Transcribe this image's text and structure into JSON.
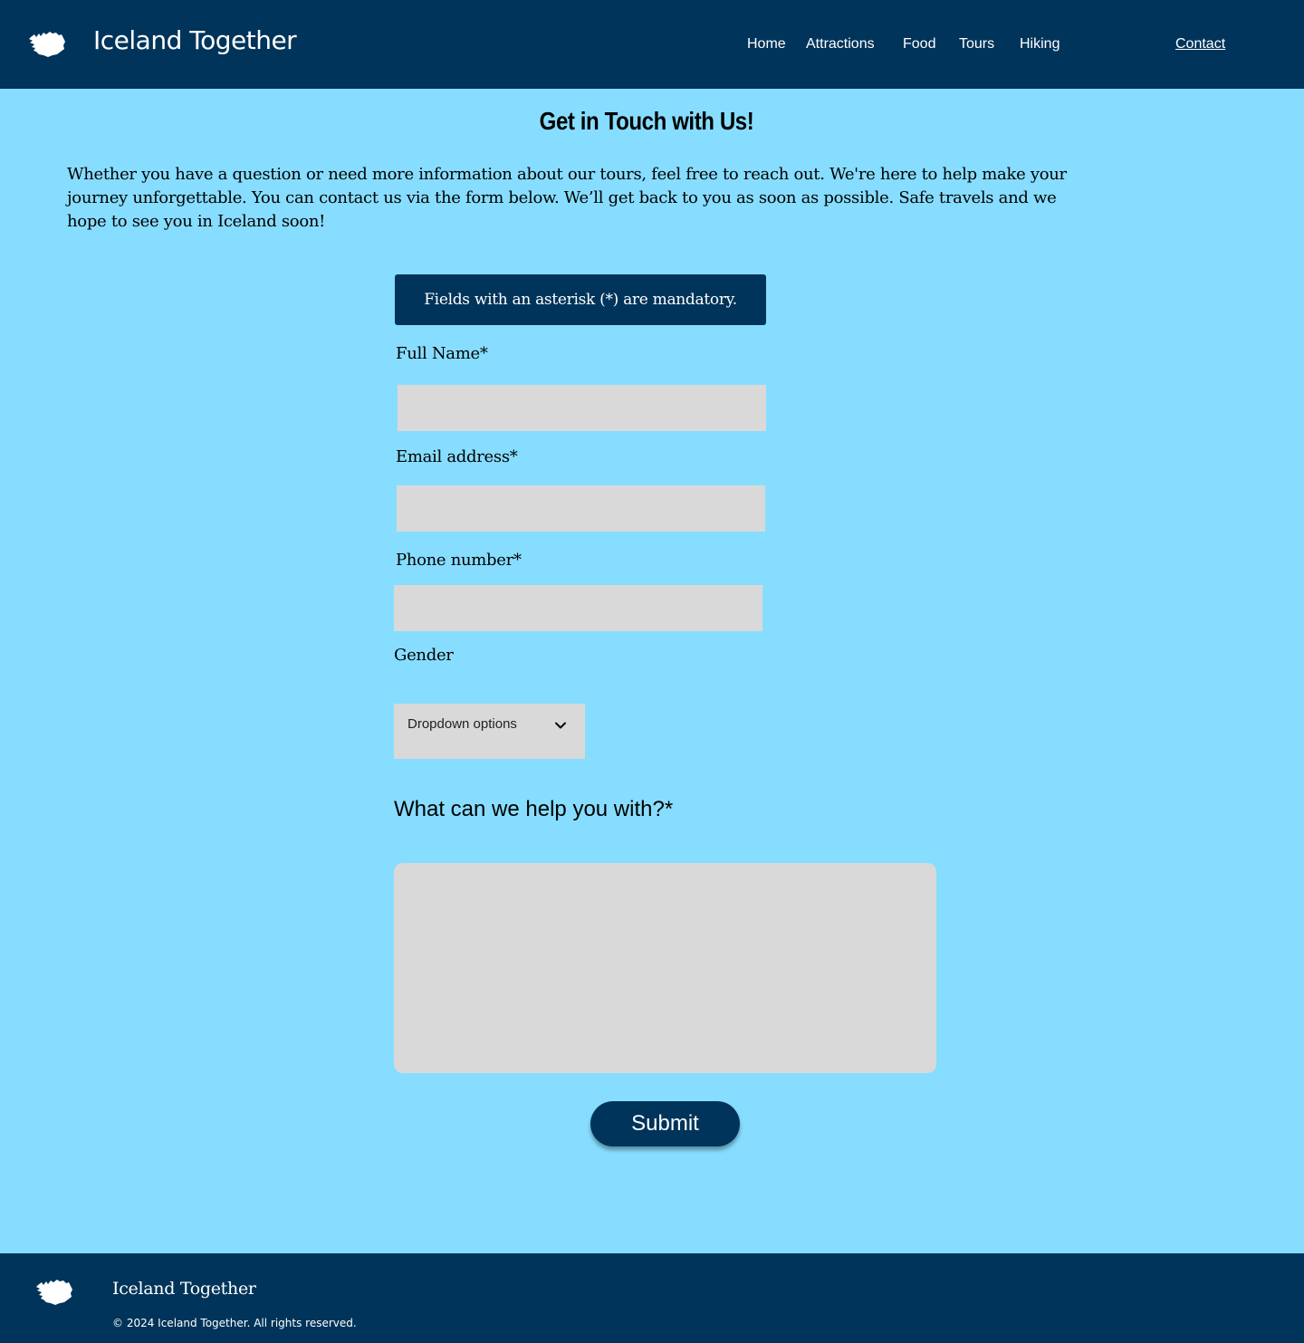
{
  "header": {
    "brand": "Iceland Together",
    "logo_icon": "iceland-map-icon",
    "nav": [
      {
        "label": "Home"
      },
      {
        "label": "Attractions"
      },
      {
        "label": "Food"
      },
      {
        "label": "Tours"
      },
      {
        "label": "Hiking"
      },
      {
        "label": "Contact",
        "active": true
      }
    ]
  },
  "main": {
    "title": "Get in Touch with Us!",
    "intro": "Whether you have a question or need more information about our tours, feel free to reach out. We're here to help make your journey unforgettable. You can contact us via the form below. We’ll get back to you as soon as possible. Safe travels and we hope to see you in Iceland soon!",
    "notice": "Fields with an asterisk (*) are mandatory.",
    "form": {
      "full_name_label": "Full Name*",
      "full_name_value": "",
      "email_label": "Email address*",
      "email_value": "",
      "phone_label": "Phone number*",
      "phone_value": "",
      "gender_label": "Gender",
      "gender_selected": "Dropdown options",
      "message_label": "What can we help you with?*",
      "message_value": "",
      "submit_label": "Submit"
    }
  },
  "footer": {
    "brand": "Iceland Together",
    "copyright": "© 2024 Iceland Together. All rights reserved."
  },
  "colors": {
    "background": "#87ddff",
    "primary": "#00345a",
    "field": "#d9d9d9"
  }
}
